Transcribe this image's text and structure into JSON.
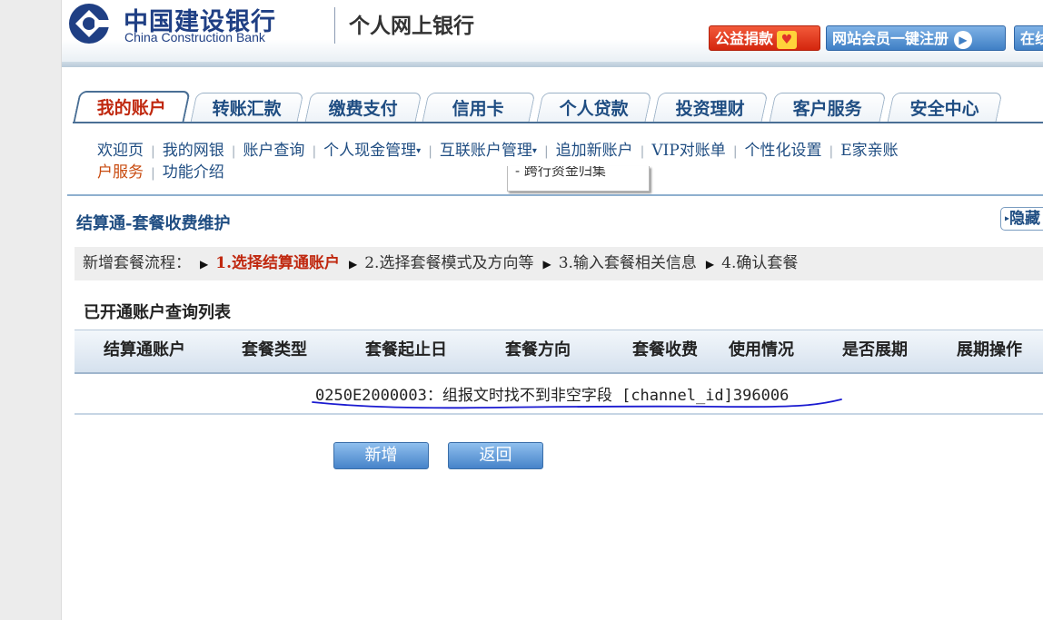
{
  "header": {
    "brand_cn": "中国建设银行",
    "brand_en": "China Construction Bank",
    "product": "个人网上银行",
    "charity_button": "公益捐款",
    "register_button": "网站会员一键注册",
    "online_button": "在线"
  },
  "tabs": [
    {
      "label": "我的账户",
      "active": true
    },
    {
      "label": "转账汇款"
    },
    {
      "label": "缴费支付"
    },
    {
      "label": "信用卡"
    },
    {
      "label": "个人贷款"
    },
    {
      "label": "投资理财"
    },
    {
      "label": "客户服务"
    },
    {
      "label": "安全中心"
    }
  ],
  "subnav": {
    "items": [
      "欢迎页",
      "我的网银",
      "账户查询",
      "个人现金管理",
      "互联账户管理",
      "追加新账户",
      "VIP对账单",
      "个性化设置",
      "E家亲账",
      "户服务",
      "功能介绍"
    ],
    "dropdown_option": "- 跨行资金归集"
  },
  "page": {
    "title": "结算通-套餐收费维护",
    "hide_button": "隐藏"
  },
  "steps": {
    "prefix": "新增套餐流程：",
    "items": [
      "1.选择结算通账户",
      "2.选择套餐模式及方向等",
      "3.输入套餐相关信息",
      "4.确认套餐"
    ],
    "current_index": 0
  },
  "list": {
    "title": "已开通账户查询列表",
    "columns": [
      "结算通账户",
      "套餐类型",
      "套餐起止日",
      "套餐方向",
      "套餐收费",
      "使用情况",
      "是否展期",
      "展期操作"
    ],
    "error_code": "0250E2000003：",
    "error_text": "组报文时找不到非空字段",
    "error_field": "[channel_id]396006"
  },
  "buttons": {
    "add": "新增",
    "back": "返回"
  },
  "colors": {
    "brand_blue": "#1f3f84",
    "nav_blue": "#1f4d82",
    "active_red": "#c0280f",
    "annotation_ink": "#1a1ad0"
  }
}
